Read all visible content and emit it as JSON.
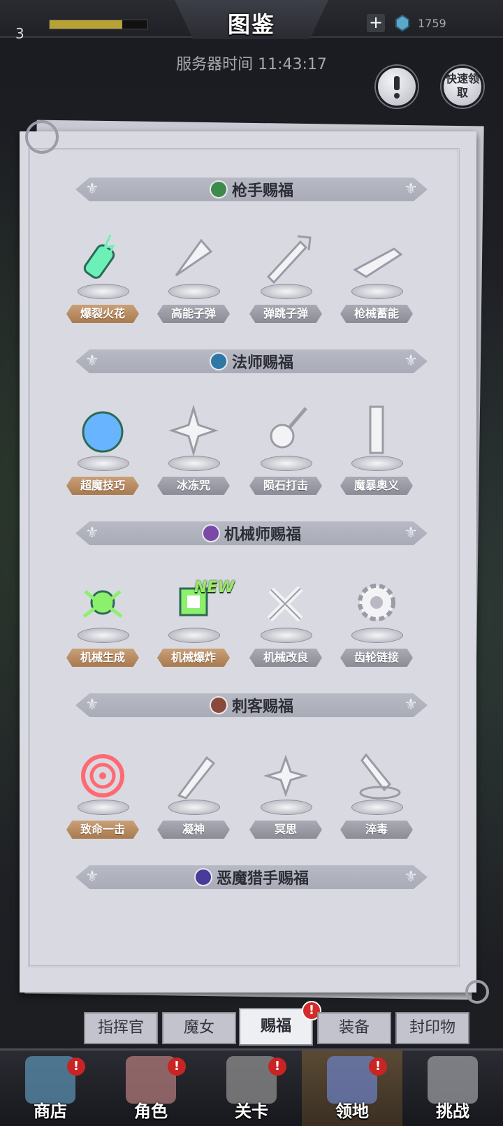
{
  "header": {
    "title": "图鉴",
    "level": "3",
    "gems": "1759",
    "server_time_label": "服务器时间 11:43:17",
    "quick_claim_label": "快速领取",
    "xp_fraction": 0.74
  },
  "sections": [
    {
      "title": "枪手赐福",
      "icon_color": "#3e8a4c",
      "skills": [
        {
          "name": "爆裂火花",
          "unlocked": true
        },
        {
          "name": "高能子弹",
          "unlocked": false
        },
        {
          "name": "弹跳子弹",
          "unlocked": false
        },
        {
          "name": "枪械蓄能",
          "unlocked": false
        }
      ]
    },
    {
      "title": "法师赐福",
      "icon_color": "#2f78a6",
      "skills": [
        {
          "name": "超魔技巧",
          "unlocked": true
        },
        {
          "name": "冰冻咒",
          "unlocked": false
        },
        {
          "name": "陨石打击",
          "unlocked": false
        },
        {
          "name": "魔暴奥义",
          "unlocked": false
        }
      ]
    },
    {
      "title": "机械师赐福",
      "icon_color": "#7a4aa6",
      "skills": [
        {
          "name": "机械生成",
          "unlocked": true
        },
        {
          "name": "机械爆炸",
          "unlocked": true
        },
        {
          "name": "机械改良",
          "unlocked": false
        },
        {
          "name": "齿轮链接",
          "unlocked": false
        }
      ]
    },
    {
      "title": "刺客赐福",
      "icon_color": "#8a4a3a",
      "skills": [
        {
          "name": "致命一击",
          "unlocked": true
        },
        {
          "name": "凝神",
          "unlocked": false
        },
        {
          "name": "冥思",
          "unlocked": false
        },
        {
          "name": "淬毒",
          "unlocked": false
        }
      ]
    },
    {
      "title": "恶魔猎手赐福",
      "icon_color": "#4a3a9a",
      "skills": []
    }
  ],
  "new_badge": "NEW",
  "tabs": [
    "指挥官",
    "魔女",
    "赐福",
    "装备",
    "封印物"
  ],
  "active_tab": "赐福",
  "bottom_nav": [
    {
      "label": "商店",
      "alert": "!"
    },
    {
      "label": "角色",
      "alert": "!"
    },
    {
      "label": "关卡",
      "alert": "!"
    },
    {
      "label": "领地",
      "alert": "!"
    },
    {
      "label": "挑战",
      "alert": ""
    }
  ],
  "alert_mark": "!",
  "colors": {
    "gold_tag": "#b8895e",
    "grey_tag": "#9a9ba5",
    "paper": "#d9dae1",
    "alert": "#d52a2a"
  },
  "icons": {
    "section_1": "green-gun-icon",
    "section_2": "blue-wand-icon",
    "section_3": "purple-gear-icon",
    "section_4": "red-swirl-icon",
    "section_5": "purple-claw-icon",
    "skills": [
      "spark-bottle-icon",
      "bullet-icon",
      "bounce-bullet-icon",
      "rifle-icon",
      "arcane-orb-icon",
      "frost-icon",
      "meteor-icon",
      "storm-pillar-icon",
      "spider-mech-icon",
      "chip-explosion-icon",
      "wrench-icon",
      "gear-icon",
      "target-icon",
      "kunai-icon",
      "shuriken-icon",
      "poison-dagger-icon"
    ]
  }
}
